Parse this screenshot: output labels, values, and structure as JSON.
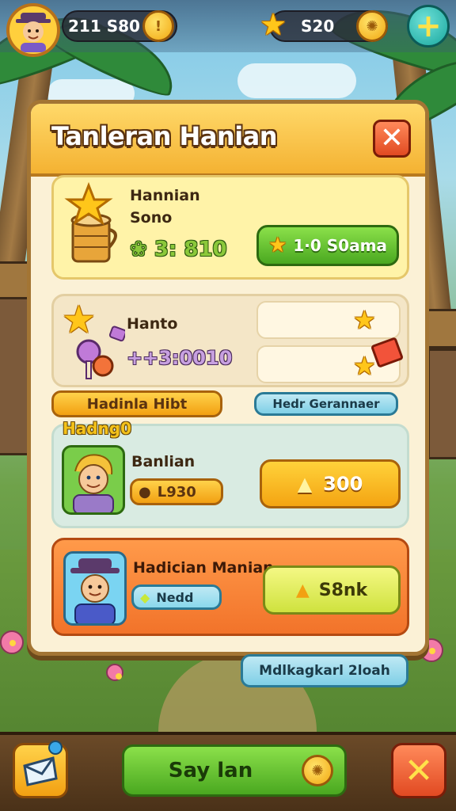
{
  "top_bar": {
    "currency_primary": "211 S80",
    "currency_primary_icon": "coin-icon",
    "currency_secondary": "S20",
    "star_icon": "star-icon",
    "plus_icon": "plus-icon"
  },
  "panel": {
    "title": "Tanleran Hanian",
    "close_icon": "close-icon"
  },
  "card1": {
    "title": "Hannian",
    "subtitle": "Sono",
    "value": "❀ 3: 810",
    "button_label": "1·0  S0ama"
  },
  "card2": {
    "title": "Hanto",
    "value": "++3:0010"
  },
  "left_badge": "Hadinla Hibt",
  "right_badge": "Hedr Gerannaer",
  "section_label": "Hadng0",
  "card3": {
    "name": "Banlian",
    "value": "L930",
    "button_label": "300"
  },
  "card4": {
    "name": "Hadician Manian",
    "value": "Nedd",
    "button_label": "S8nk"
  },
  "footer_badge": "Mdlkagkarl 2loah",
  "bottom_bar": {
    "main_button_label": "Say lan",
    "left_icon": "envelope-icon",
    "right_icon": "close-icon"
  },
  "colors": {
    "panel_bg": "#fbf1d6",
    "header": "#f4b232",
    "green": "#4aa820",
    "orange": "#f2732a"
  }
}
